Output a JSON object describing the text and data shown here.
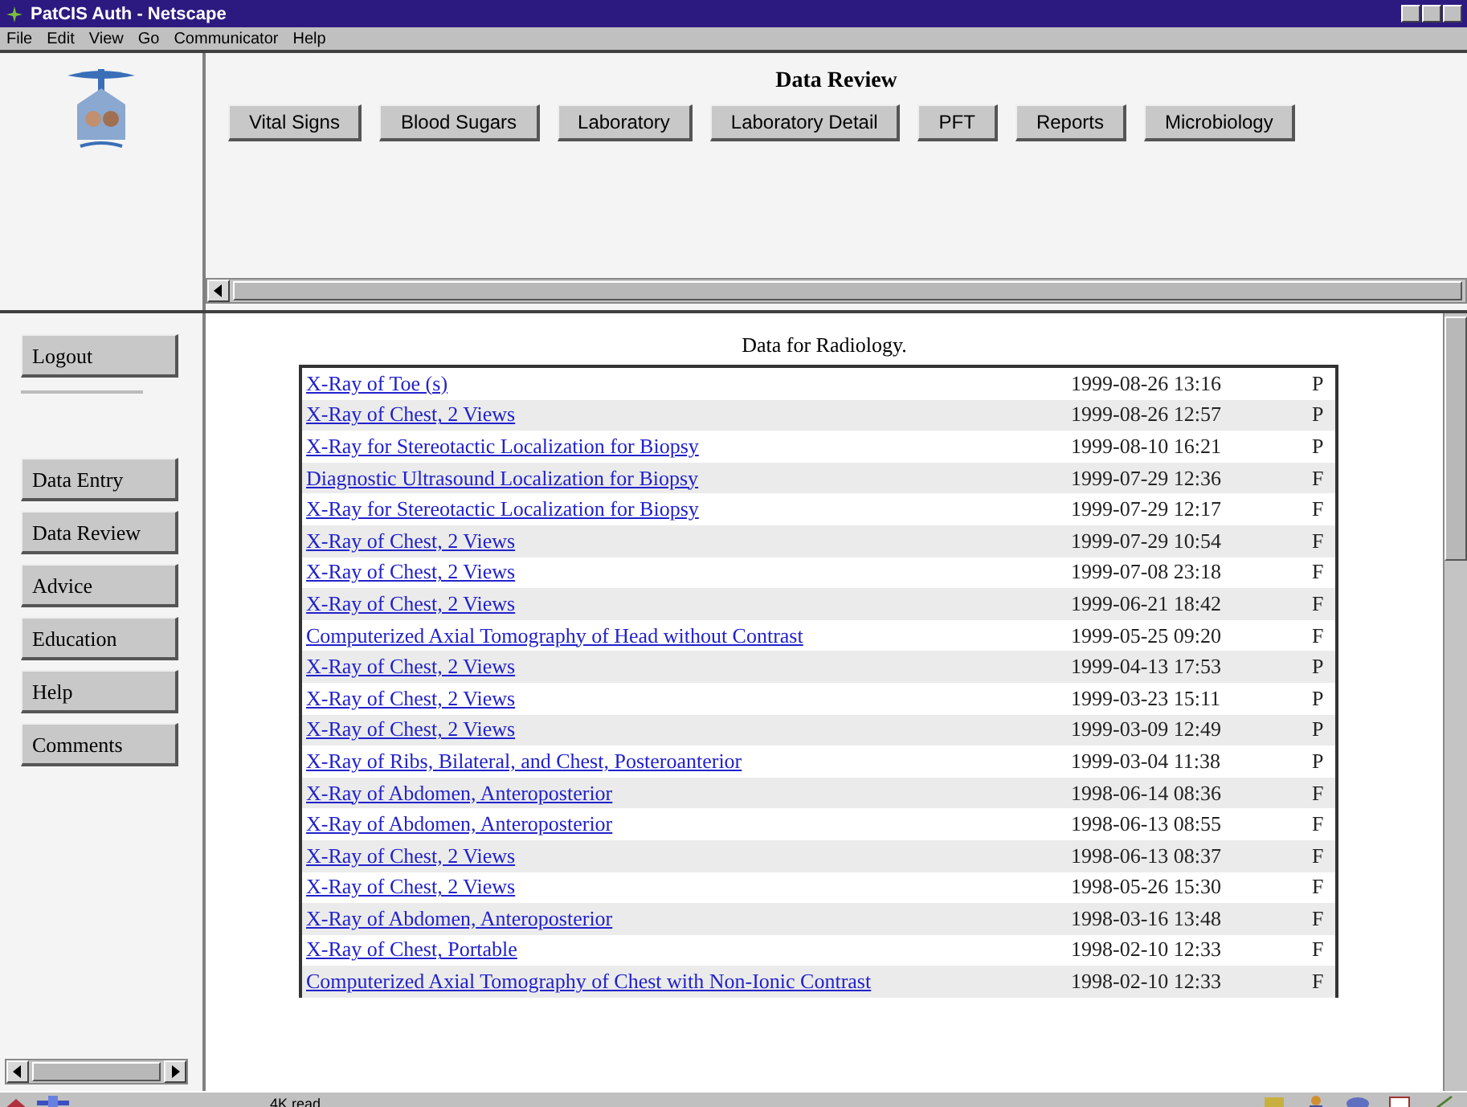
{
  "window": {
    "title": "PatCIS Auth - Netscape"
  },
  "menu": [
    "File",
    "Edit",
    "View",
    "Go",
    "Communicator",
    "Help"
  ],
  "header": {
    "title": "Data Review",
    "buttons": [
      "Vital Signs",
      "Blood Sugars",
      "Laboratory",
      "Laboratory Detail",
      "PFT",
      "Reports",
      "Microbiology"
    ]
  },
  "sidebar": {
    "logout": "Logout",
    "buttons": [
      "Data Entry",
      "Data Review",
      "Advice",
      "Education",
      "Help",
      "Comments"
    ]
  },
  "content": {
    "heading": "Data for Radiology.",
    "rows": [
      {
        "name": "X-Ray of Toe (s)",
        "date": "1999-08-26 13:16",
        "status": "P"
      },
      {
        "name": "X-Ray of Chest, 2 Views",
        "date": "1999-08-26 12:57",
        "status": "P"
      },
      {
        "name": "X-Ray for Stereotactic Localization for Biopsy",
        "date": "1999-08-10 16:21",
        "status": "P"
      },
      {
        "name": "Diagnostic Ultrasound Localization for Biopsy",
        "date": "1999-07-29 12:36",
        "status": "F"
      },
      {
        "name": "X-Ray for Stereotactic Localization for Biopsy",
        "date": "1999-07-29 12:17",
        "status": "F"
      },
      {
        "name": "X-Ray of Chest, 2 Views",
        "date": "1999-07-29 10:54",
        "status": "F"
      },
      {
        "name": "X-Ray of Chest, 2 Views",
        "date": "1999-07-08 23:18",
        "status": "F"
      },
      {
        "name": "X-Ray of Chest, 2 Views",
        "date": "1999-06-21 18:42",
        "status": "F"
      },
      {
        "name": "Computerized Axial Tomography of Head without Contrast",
        "date": "1999-05-25 09:20",
        "status": "F"
      },
      {
        "name": "X-Ray of Chest, 2 Views",
        "date": "1999-04-13 17:53",
        "status": "P"
      },
      {
        "name": "X-Ray of Chest, 2 Views",
        "date": "1999-03-23 15:11",
        "status": "P"
      },
      {
        "name": "X-Ray of Chest, 2 Views",
        "date": "1999-03-09 12:49",
        "status": "P"
      },
      {
        "name": "X-Ray of Ribs, Bilateral, and Chest, Posteroanterior",
        "date": "1999-03-04 11:38",
        "status": "P"
      },
      {
        "name": "X-Ray of Abdomen, Anteroposterior",
        "date": "1998-06-14 08:36",
        "status": "F"
      },
      {
        "name": "X-Ray of Abdomen, Anteroposterior",
        "date": "1998-06-13 08:55",
        "status": "F"
      },
      {
        "name": "X-Ray of Chest, 2 Views",
        "date": "1998-06-13 08:37",
        "status": "F"
      },
      {
        "name": "X-Ray of Chest, 2 Views",
        "date": "1998-05-26 15:30",
        "status": "F"
      },
      {
        "name": "X-Ray of Abdomen, Anteroposterior",
        "date": "1998-03-16 13:48",
        "status": "F"
      },
      {
        "name": "X-Ray of Chest, Portable",
        "date": "1998-02-10 12:33",
        "status": "F"
      },
      {
        "name": "Computerized Axial Tomography of Chest with Non-Ionic Contrast",
        "date": "1998-02-10 12:33",
        "status": "F"
      }
    ]
  },
  "status_bar": {
    "text": "4K read"
  }
}
